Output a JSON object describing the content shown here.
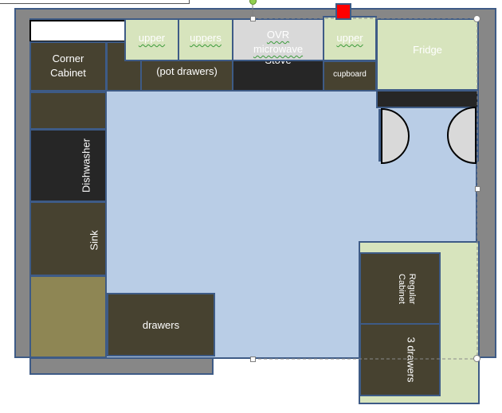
{
  "colors": {
    "wall": "#878787",
    "floor": "#b9cde6",
    "cabinet_dark": "#474230",
    "appliance_black": "#262626",
    "upper_green": "#d7e4bd",
    "counter_olive": "#8e8654",
    "microwave_gray": "#d9d9d9",
    "outline": "#3e5b86",
    "selected_marker": "#ff0000"
  },
  "top_row": {
    "upper_left": "upper",
    "uppers": "uppers",
    "microwave": "OVR microwave",
    "upper_right": "upper",
    "fridge": "Fridge",
    "pot_drawers": "(pot drawers)",
    "stove": "Stove",
    "cupboard": "cupboard"
  },
  "left_column": {
    "corner_cabinet": "Corner Cabinet",
    "dishwasher": "Dishwasher",
    "sink": "Sink"
  },
  "bottom_row": {
    "drawers": "drawers"
  },
  "right_island": {
    "regular_cabinet": "Regular Cabinet",
    "three_drawers": "3 drawers"
  }
}
